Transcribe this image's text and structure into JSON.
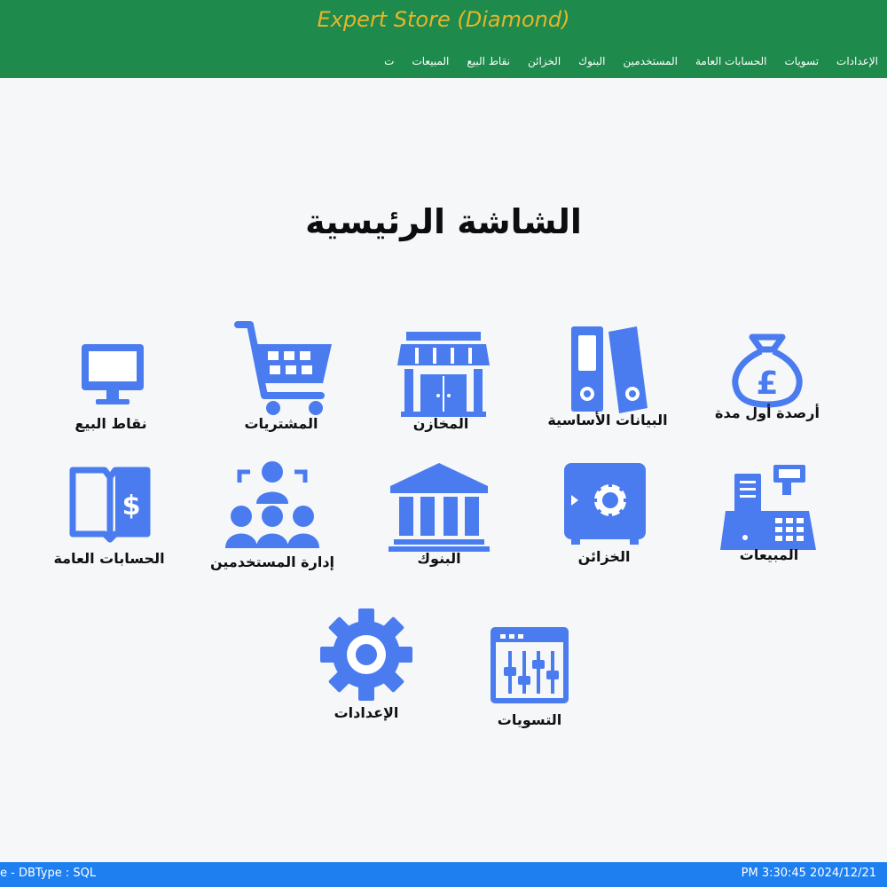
{
  "header": {
    "title": "Expert Store (Diamond)",
    "menu": [
      "ت",
      "المبيعات",
      "نقاط البيع",
      "الخزائن",
      "البنوك",
      "المستخدمين",
      "الحسابات العامة",
      "تسويات",
      "الإعدادات"
    ]
  },
  "main": {
    "title": "الشاشة الرئيسية",
    "tiles": [
      {
        "label": "أرصدة أول مدة",
        "icon": "money-bag-icon"
      },
      {
        "label": "البيانات الأساسية",
        "icon": "binders-icon"
      },
      {
        "label": "المخازن",
        "icon": "store-icon"
      },
      {
        "label": "المشتريات",
        "icon": "shopping-cart-icon"
      },
      {
        "label": "نقاط البيع",
        "icon": "monitor-icon"
      },
      {
        "label": "المبيعات",
        "icon": "cash-register-icon"
      },
      {
        "label": "الخزائن",
        "icon": "safe-icon"
      },
      {
        "label": "البنوك",
        "icon": "bank-icon"
      },
      {
        "label": "إدارة المستخدمين",
        "icon": "users-icon"
      },
      {
        "label": "الحسابات العامة",
        "icon": "ledger-icon"
      },
      {
        "label": "التسويات",
        "icon": "sliders-icon"
      },
      {
        "label": "الإعدادات",
        "icon": "gear-icon"
      }
    ]
  },
  "status": {
    "left": "e  -  DBType :  SQL",
    "right": "PM 3:30:45 2024/12/21"
  },
  "colors": {
    "header": "#1e8a4c",
    "title": "#e7b52a",
    "icon": "#4a7cf0",
    "status": "#1e7ff0"
  }
}
